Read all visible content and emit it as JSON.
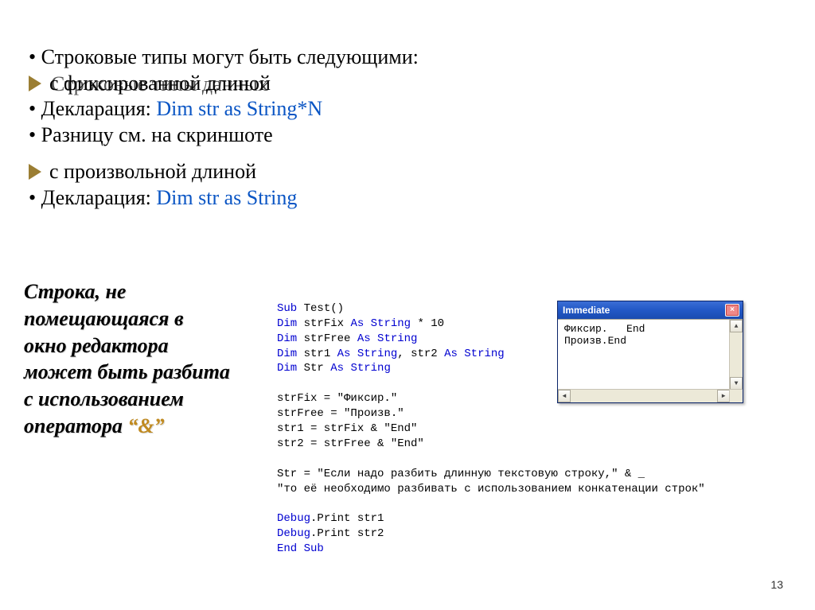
{
  "top": {
    "l1": "Строковые типы могут быть следующими:",
    "ghost": "Строковые типы данных",
    "l2": "с фиксированной длиной",
    "l3a": "Декларация: ",
    "l3b": "Dim str as String*N",
    "l4": "Разницу см. на скриншоте",
    "l5": "с произвольной длиной",
    "l6a": "Декларация: ",
    "l6b": "Dim str as String"
  },
  "note": {
    "t1": "Строка, не",
    "t2": "помещающаяся в",
    "t3": "окно редактора",
    "t4": "может быть разбита",
    "t5": "с использованием",
    "t6a": "оператора ",
    "t6b": "“&”"
  },
  "code": {
    "c01a": "Sub",
    "c01b": " Test()",
    "c02a": "Dim",
    "c02b": " strFix ",
    "c02c": "As String",
    "c02d": " * 10",
    "c03a": "Dim",
    "c03b": " strFree ",
    "c03c": "As String",
    "c04a": "Dim",
    "c04b": " str1 ",
    "c04c": "As String",
    "c04d": ", str2 ",
    "c04e": "As String",
    "c05a": "Dim",
    "c05b": " Str ",
    "c05c": "As String",
    "c06": "",
    "c07": "strFix = \"Фиксир.\"",
    "c08": "strFree = \"Произв.\"",
    "c09": "str1 = strFix & \"End\"",
    "c10": "str2 = strFree & \"End\"",
    "c11": "",
    "c12": "Str = \"Если надо разбить длинную текстовую строку,\" & _",
    "c13": "\"то её необходимо разбивать с использованием конкатенации строк\"",
    "c14": "",
    "c15a": "Debug",
    "c15b": ".Print str1",
    "c16a": "Debug",
    "c16b": ".Print str2",
    "c17": "End Sub"
  },
  "immediate": {
    "title": "Immediate",
    "line1": "Фиксир.   End",
    "line2": "Произв.End"
  },
  "page": "13"
}
